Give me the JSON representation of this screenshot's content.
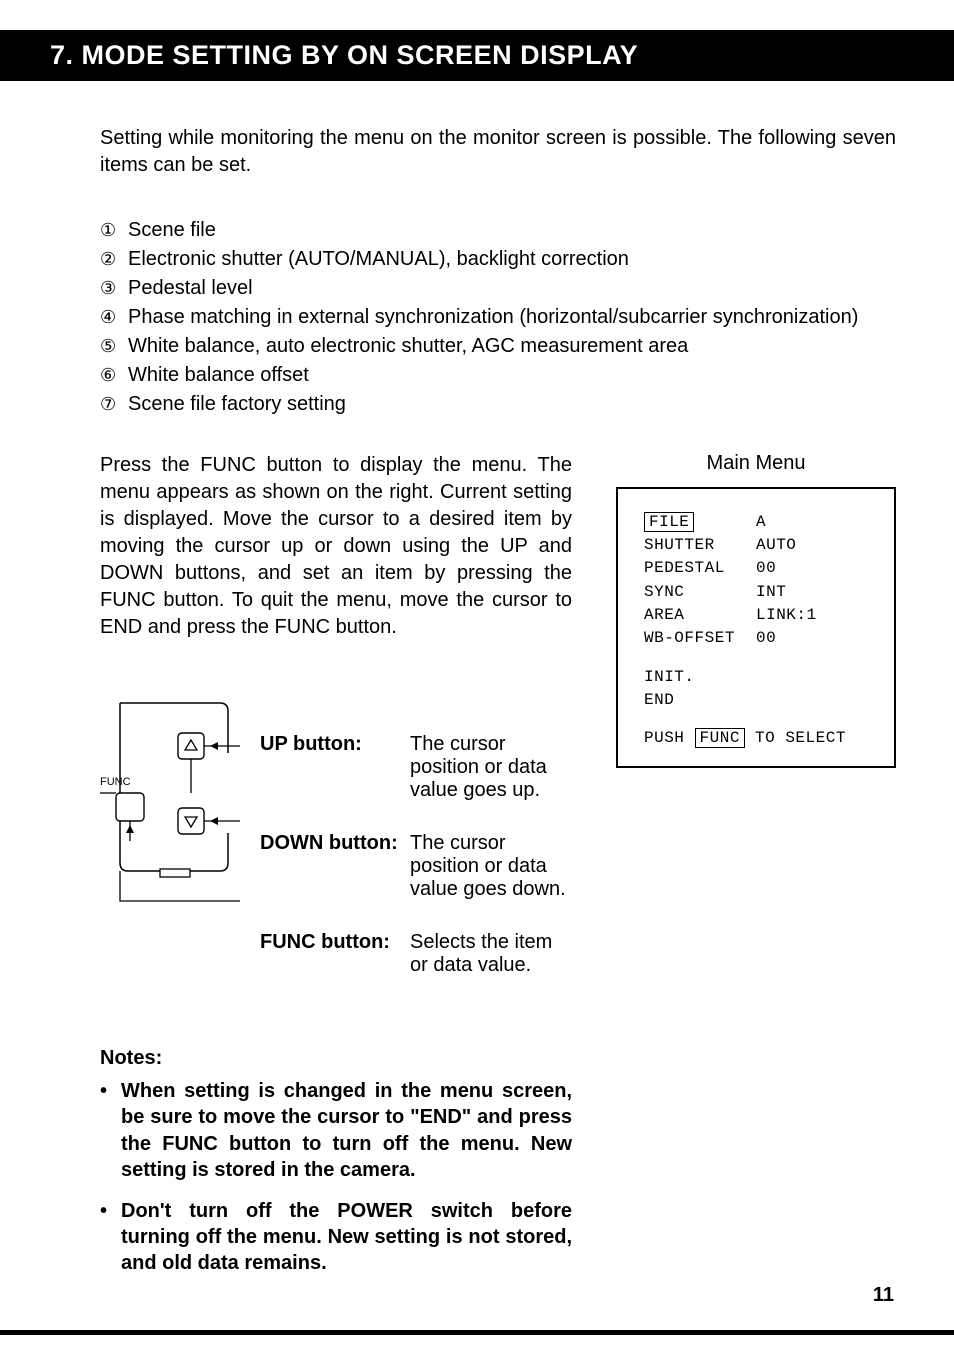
{
  "header": {
    "title": "7. MODE SETTING BY ON SCREEN DISPLAY"
  },
  "intro": "Setting while monitoring the menu on the monitor screen is possible. The following seven items can be set.",
  "items": [
    {
      "num": "①",
      "text": "Scene file"
    },
    {
      "num": "②",
      "text": "Electronic shutter (AUTO/MANUAL), backlight correction"
    },
    {
      "num": "③",
      "text": "Pedestal level"
    },
    {
      "num": "④",
      "text": "Phase matching in external synchronization (horizontal/subcarrier synchronization)"
    },
    {
      "num": "⑤",
      "text": "White balance, auto electronic shutter, AGC measurement area"
    },
    {
      "num": "⑥",
      "text": "White balance offset"
    },
    {
      "num": "⑦",
      "text": "Scene file factory setting"
    }
  ],
  "instructions": "Press the FUNC button to display the menu. The menu appears as shown on the right. Current set­ting is displayed. Move the cursor to a desired item by moving the cursor up or down using the UP and DOWN buttons, and set an item by pressing the FUNC button. To quit the menu, move the cursor to END and press the FUNC button.",
  "mainmenu": {
    "title": "Main Menu",
    "rows": [
      {
        "key": "FILE",
        "val": "A",
        "selected": true
      },
      {
        "key": "SHUTTER",
        "val": "AUTO"
      },
      {
        "key": "PEDESTAL",
        "val": "00"
      },
      {
        "key": "SYNC",
        "val": "INT"
      },
      {
        "key": "AREA",
        "val": "LINK:1"
      },
      {
        "key": "WB-OFFSET",
        "val": "00"
      }
    ],
    "extra": [
      "INIT.",
      "END"
    ],
    "footer_pre": "PUSH ",
    "footer_box": "FUNC",
    "footer_post": " TO SELECT"
  },
  "diagram": {
    "func_label": "FUNC",
    "up": {
      "label": "UP button:",
      "desc": "The cursor position or data value goes up."
    },
    "down": {
      "label": "DOWN button:",
      "desc": "The cursor position or data value goes down."
    },
    "func": {
      "label": "FUNC button:",
      "desc": "Selects the item or data value."
    }
  },
  "notes": {
    "heading": "Notes:",
    "list": [
      "When setting is changed in the menu screen, be sure to move the cursor to \"END\" and press the FUNC button to turn off the menu. New setting is stored in the camera.",
      "Don't turn off the POWER switch before turning off the menu. New setting is not stored, and old data remains."
    ]
  },
  "page_number": "11"
}
